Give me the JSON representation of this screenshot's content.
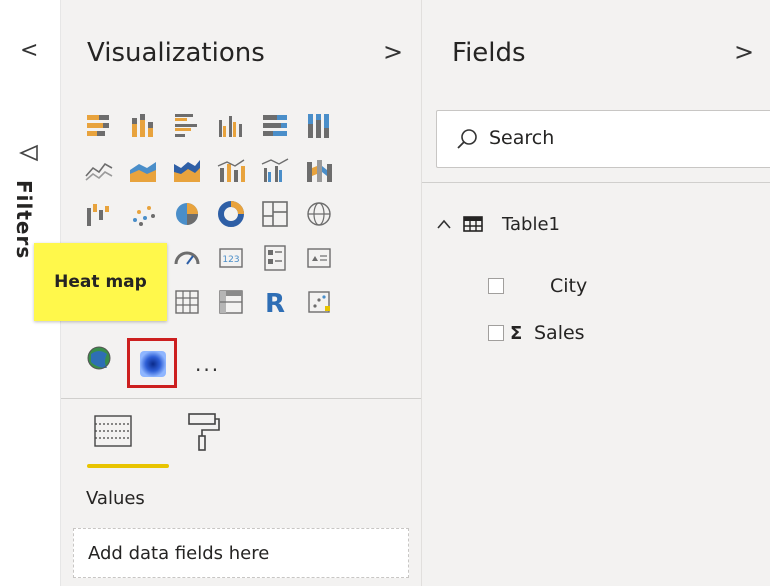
{
  "filters": {
    "collapse_glyph": "<",
    "label": "Filters"
  },
  "visualizations": {
    "title": "Visualizations",
    "expand_glyph": ">",
    "selected_visual": "heat-map",
    "tooltip": "Heat map",
    "more_glyph": "...",
    "visuals": [
      "stacked-bar-chart",
      "stacked-column-chart",
      "clustered-bar-chart",
      "clustered-column-chart",
      "100-stacked-bar-chart",
      "100-stacked-column-chart",
      "line-chart",
      "area-chart",
      "stacked-area-chart",
      "line-and-stacked-column-chart",
      "line-and-clustered-column-chart",
      "ribbon-chart",
      "waterfall-chart",
      "scatter-chart",
      "pie-chart",
      "donut-chart",
      "treemap",
      "map",
      "filled-map",
      "funnel",
      "gauge",
      "card",
      "multi-row-card",
      "kpi",
      "slicer",
      "table",
      "matrix",
      "r-script-visual",
      "python-visual",
      "key-influencers",
      "arcgis-map",
      "heat-map"
    ],
    "tabs": [
      "fields-tab",
      "format-tab"
    ],
    "values_label": "Values",
    "add_fields_placeholder": "Add data fields here",
    "accent_color": "#e8c400",
    "highlight_color": "#cc1f1f",
    "tooltip_color": "#fff84b"
  },
  "fields": {
    "title": "Fields",
    "expand_glyph": ">",
    "search_placeholder": "Search",
    "table": {
      "chevron": "^",
      "name": "Table1",
      "fields": [
        {
          "name": "City",
          "sigma": ""
        },
        {
          "name": "Sales",
          "sigma": "Σ"
        }
      ]
    }
  }
}
